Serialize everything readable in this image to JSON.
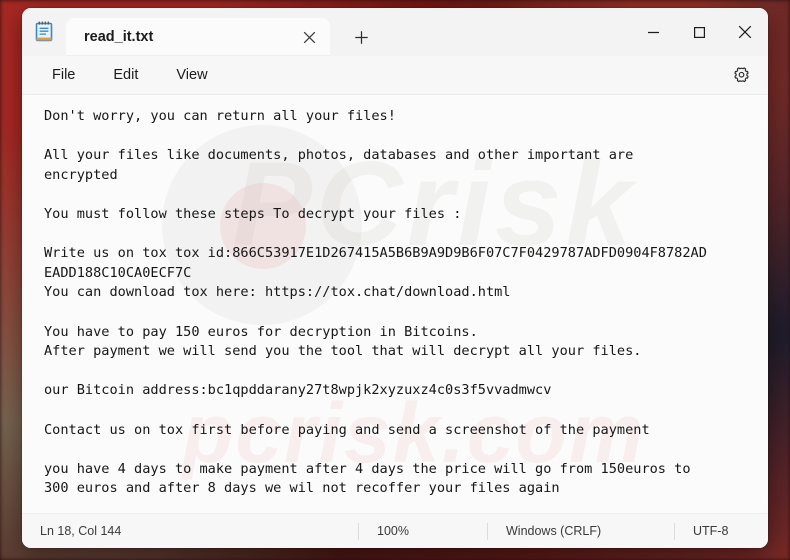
{
  "window": {
    "app_icon": "notepad-icon",
    "tab_title": "read_it.txt",
    "close_tab_icon": "close-icon",
    "new_tab_icon": "plus-icon",
    "minimize_icon": "minimize-icon",
    "maximize_icon": "maximize-icon",
    "close_icon": "close-icon"
  },
  "menu": {
    "file": "File",
    "edit": "Edit",
    "view": "View",
    "settings_icon": "gear-icon"
  },
  "note": {
    "line_01": "Don't worry, you can return all your files!",
    "line_02": "All your files like documents, photos, databases and other important are",
    "line_03": "encrypted",
    "line_04": "You must follow these steps To decrypt your files :",
    "line_05": "Write us on tox tox id:866C53917E1D267415A5B6B9A9D9B6F07C7F0429787ADFD0904F8782AD",
    "line_06": "EADD188C10CA0ECF7C",
    "line_07": "You can download tox here: https://tox.chat/download.html",
    "line_08": "You have to pay 150 euros for decryption in Bitcoins.",
    "line_09": "After payment we will send you the tool that will decrypt all your files.",
    "line_10": "our Bitcoin address:bc1qpddarany27t8wpjk2xyzuxz4c0s3f5vvadmwcv",
    "line_11": "Contact us on tox first before paying and send a screenshot of the payment",
    "line_12": "you have 4 days to make payment after 4 days the price will go from 150euros to",
    "line_13": "300 euros and after 8 days we wil not recoffer your files again"
  },
  "status": {
    "position": "Ln 18, Col 144",
    "zoom": "100%",
    "line_ending": "Windows (CRLF)",
    "encoding": "UTF-8"
  },
  "watermark": {
    "text_top": "PCrisk",
    "text_bottom": "pcrisk.com"
  },
  "colors": {
    "window_bg": "#f7f7f7",
    "editor_bg": "#fbfbfb",
    "text": "#161616",
    "tab_active": "#fbfbfb",
    "accent_icon": "#3a8ac7"
  }
}
